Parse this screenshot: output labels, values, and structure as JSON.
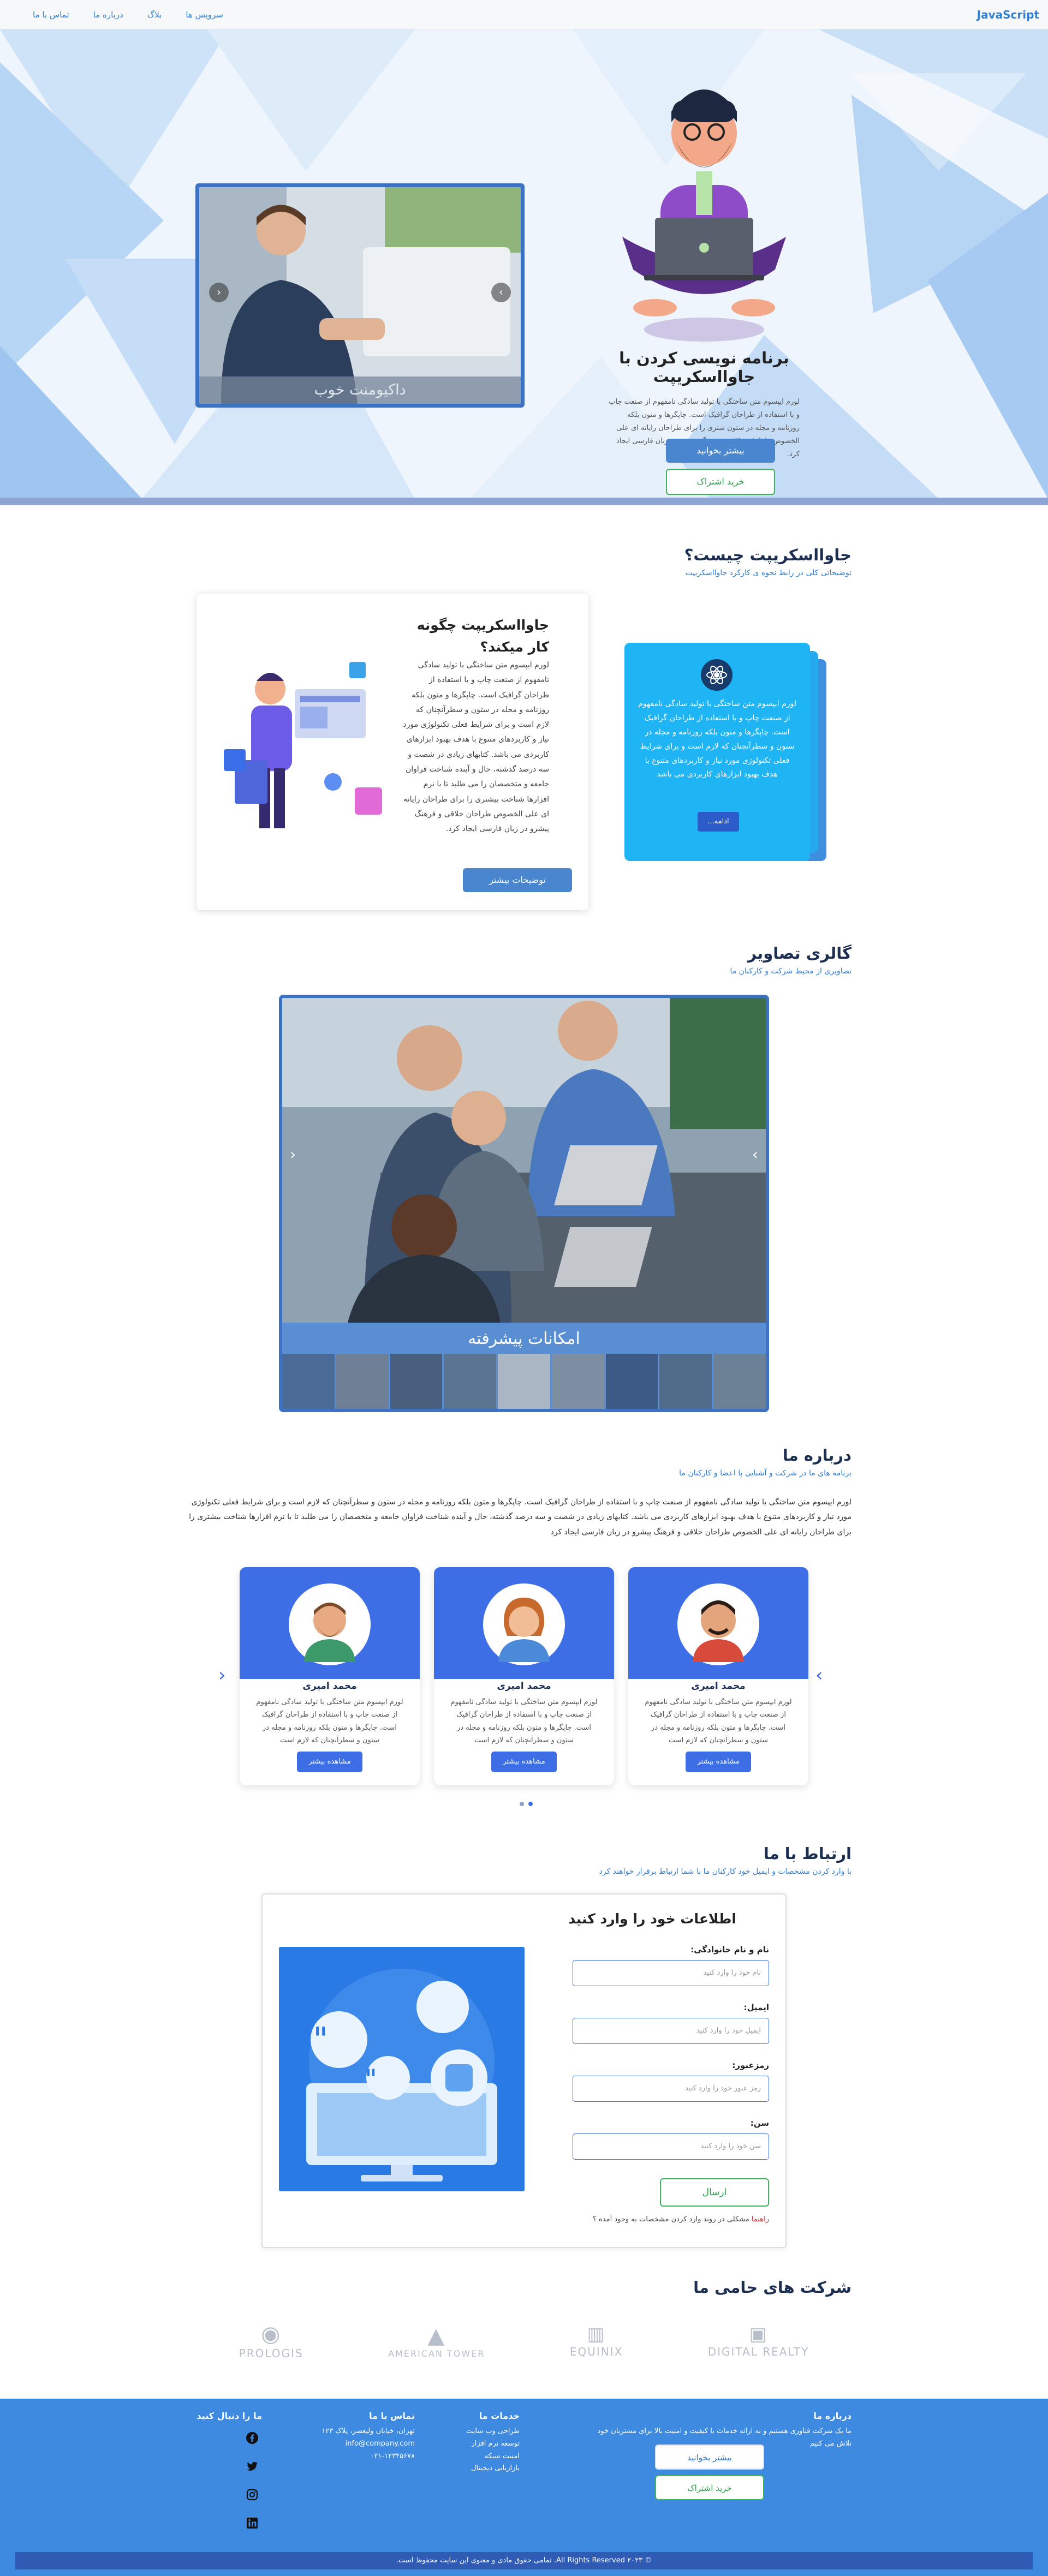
{
  "nav": {
    "brand": "JavaScript",
    "links": [
      "سرویس ها",
      "بلاگ",
      "درباره ما",
      "تماس با ما"
    ]
  },
  "hero": {
    "title": "برنامه نویسی کردن با جاوااسکریپت",
    "text": "لورم ایپسوم متن ساختگی با تولید سادگی نامفهوم از صنعت چاپ و با استفاده از طراحان گرافیک است. چاپگرها و متون بلکه روزنامه و مجله در ستون شتری را برای طراحان رایانه ای علی الخصوص طراحان خلاقی و فرهنگ پیشرو در زبان فارسی ایجاد کرد.",
    "btn_read": "بیشتر بخوانید",
    "btn_buy": "خرید اشتراک",
    "slider_caption": "داکیومنت خوب",
    "slider_prev": "‹",
    "slider_next": "›"
  },
  "what": {
    "title": "جاوااسکریپت چیست؟",
    "subtitle": "توضیحاتی کلی در رابط نحوه ی کارکرد جاوااسکریپت",
    "how_title": "جاوااسکریپت چگونه کار میکند؟",
    "how_text": "لورم ایپسوم متن ساختگی با تولید سادگی نامفهوم از صنعت چاپ و با استفاده از طراحان گرافیک است. چاپگرها و متون بلکه روزنامه و مجله در ستون و سطرآنچنان که لازم است و برای شرایط فعلی تکنولوژی مورد نیاز و کاربردهای متنوع با هدف بهبود ابزارهای کاربردی می باشد. کتابهای زیادی در شصت و سه درصد گذشته، حال و آینده شناخت فراوان جامعه و متخصصان را می طلبد تا با نرم افزارها شناخت بیشتری را برای طراحان رایانه ای علی الخصوص طراحان خلاقی و فرهنگ پیشرو در زبان فارسی ایجاد کرد.",
    "how_btn": "توضیحات بیشتر",
    "blue_text": "لورم ایپسوم متن ساختگی با تولید سادگی نامفهوم از صنعت چاپ و با استفاده از طراحان گرافیک است. چاپگرها و متون بلکه روزنامه و مجله در ستون و سطرآنچنان که لازم است و برای شرایط فعلی تکنولوژی مورد نیاز و کاربردهای متنوع با هدف بهبود ابزارهای کاربردی می باشد",
    "blue_btn": "ادامه..."
  },
  "gallery": {
    "title": "گالری تصاویر",
    "subtitle": "تصاویری از محیط شرکت و کارکنان ما",
    "caption": "امکانات پیشرفته",
    "prev": "‹",
    "next": "›"
  },
  "about": {
    "title": "درباره ما",
    "subtitle": "برنامه های ما در شرکت و آشنایی با اعضا و کارکنان ما",
    "text": "لورم ایپسوم متن ساختگی با تولید سادگی نامفهوم از صنعت چاپ و با استفاده از طراحان گرافیک است. چاپگرها و متون بلکه روزنامه و مجله در ستون و سطرآنچنان که لازم است و برای شرایط فعلی تکنولوژی مورد نیاز و کاربردهای متنوع با هدف بهبود ابزارهای کاربردی می باشد. کتابهای زیادی در شصت و سه درصد گذشته، حال و آینده شناخت فراوان جامعه و متخصصان را می طلبد تا با نرم افزارها شناخت بیشتری را برای طراحان رایانه ای علی الخصوص طراحان خلاقی و فرهنگ پیشرو در زبان فارسی ایجاد کرد",
    "members": [
      {
        "name": "محمد امیری",
        "text": "لورم ایپسوم متن ساختگی با تولید سادگی نامفهوم از صنعت چاپ و با استفاده از طراحان گرافیک است. چاپگرها و متون بلکه روزنامه و مجله در ستون و سطرآنچنان که لازم است",
        "btn": "مشاهده بیشتر"
      },
      {
        "name": "محمد امیری",
        "text": "لورم ایپسوم متن ساختگی با تولید سادگی نامفهوم از صنعت چاپ و با استفاده از طراحان گرافیک است. چاپگرها و متون بلکه روزنامه و مجله در ستون و سطرآنچنان که لازم است",
        "btn": "مشاهده بیشتر"
      },
      {
        "name": "محمد امیری",
        "text": "لورم ایپسوم متن ساختگی با تولید سادگی نامفهوم از صنعت چاپ و با استفاده از طراحان گرافیک است. چاپگرها و متون بلکه روزنامه و مجله در ستون و سطرآنچنان که لازم است",
        "btn": "مشاهده بیشتر"
      }
    ]
  },
  "contact": {
    "title": "ارتباط با ما",
    "subtitle": "با وارد کردن مشخصات و ایمیل خود کارکنان ما با شما ارتباط برقرار خواهند کرد",
    "form_title": "اطلاعات خود را وارد کنید",
    "name_label": "نام و نام خانوادگی:",
    "name_ph": "نام خود را وارد کنید",
    "email_label": "ایمیل:",
    "email_ph": "ایمیل خود را وارد کنید",
    "pass_label": "رمزعبور:",
    "pass_ph": "رمز عبور خود را وارد کنید",
    "age_label": "سن:",
    "age_ph": "سن خود را وارد کنید",
    "send": "ارسال",
    "warn": "مشکلی در روند وارد کردن مشخصات به وجود آمده ؟",
    "warn_link": "راهنما"
  },
  "sponsors": {
    "title": "شرکت های حامی ما",
    "items": [
      "DIGITAL REALTY",
      "EQUINIX",
      "AMERICAN TOWER",
      "PROLOGIS"
    ]
  },
  "footer": {
    "about_title": "درباره ما",
    "about_text": "ما یک شرکت فناوری هستیم و به ارائه خدمات با کیفیت و امنیت بالا برای مشتریان خود تلاش می کنیم",
    "btn_read": "بیشتر بخوانید",
    "btn_buy": "خرید اشتراک",
    "services_title": "خدمات ما",
    "services": [
      "طراحی وب سایت",
      "توسعه نرم افزار",
      "امنیت شبکه",
      "بازاریابی دیجیتال"
    ],
    "contact_title": "تماس با ما",
    "address": "تهران، خیابان ولیعصر، پلاک ۱۲۳",
    "email": "info@company.com",
    "phone": "۰۲۱-۱۲۳۴۵۶۷۸",
    "follow_title": "ما را دنبال کنید",
    "copyright": "© ۲۰۲۳ All Rights Reserved. تمامی حقوق مادی و معنوی این سایت محفوظ است."
  }
}
